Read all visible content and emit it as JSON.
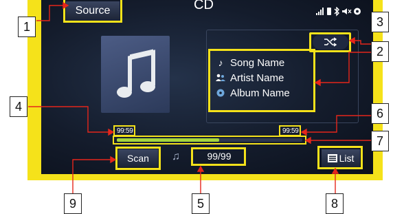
{
  "screen": {
    "title": "CD",
    "source_button_label": "Source",
    "status_icons": [
      "signal-icon",
      "phone-battery-icon",
      "bluetooth-icon",
      "mute-icon",
      "settings-disc-icon"
    ]
  },
  "track": {
    "song": "Song Name",
    "artist": "Artist Name",
    "album": "Album Name",
    "elapsed": "99:59",
    "total": "99:59",
    "track_counter": "99/99",
    "progress": 0.55
  },
  "controls": {
    "scan_label": "Scan",
    "list_label": "List",
    "shuffle_icon": "shuffle-icon",
    "note_icon": "music-note-icon"
  },
  "callouts": {
    "c1": "1",
    "c2": "2",
    "c3": "3",
    "c4": "4",
    "c5": "5",
    "c6": "6",
    "c7": "7",
    "c8": "8",
    "c9": "9"
  },
  "colors": {
    "highlight": "#f5e21a",
    "callout_line": "#e5261b",
    "progress_fill": "#a5d63c"
  }
}
